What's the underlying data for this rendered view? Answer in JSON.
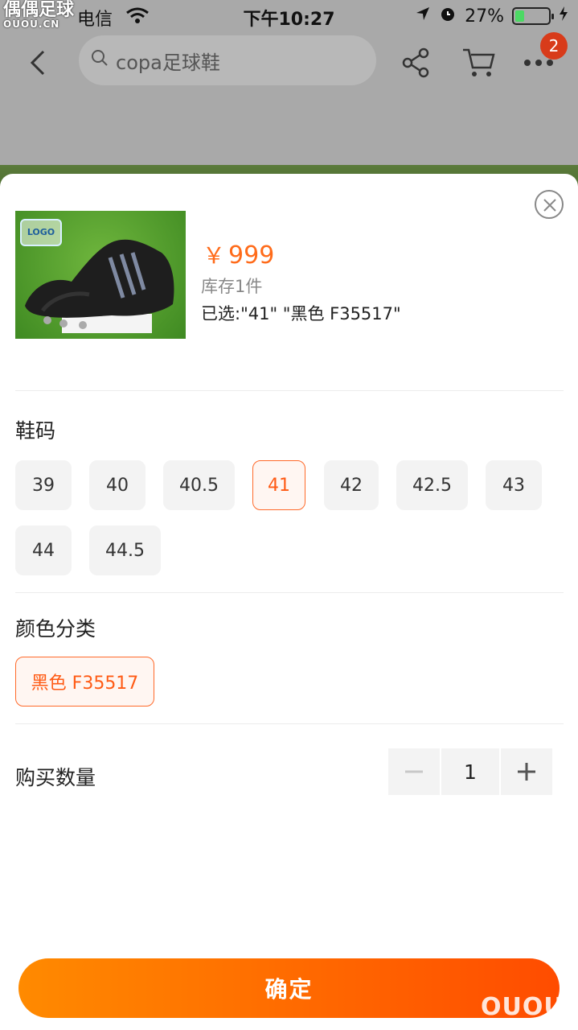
{
  "status_bar": {
    "carrier": "电信",
    "time": "下午10:27",
    "battery_percent": "27%",
    "battery_level": 0.27
  },
  "watermark": {
    "name": "偶偶足球",
    "url": "OUOU.CN",
    "corner": "OUOU"
  },
  "nav": {
    "search_text": "copa足球鞋",
    "badge_count": "2"
  },
  "product": {
    "currency": "￥",
    "price": "999",
    "stock": "库存1件",
    "selected": "已选:\"41\" \"黑色 F35517\""
  },
  "size_section": {
    "title": "鞋码",
    "options": [
      "39",
      "40",
      "40.5",
      "41",
      "42",
      "42.5",
      "43",
      "44",
      "44.5"
    ],
    "selected": "41"
  },
  "color_section": {
    "title": "颜色分类",
    "options": [
      "黑色 F35517"
    ],
    "selected": "黑色 F35517"
  },
  "quantity": {
    "label": "购买数量",
    "value": "1"
  },
  "confirm_label": "确定",
  "colors": {
    "accent": "#ff5a14",
    "button_gradient_start": "#ff8a00",
    "button_gradient_end": "#ff4c00"
  }
}
